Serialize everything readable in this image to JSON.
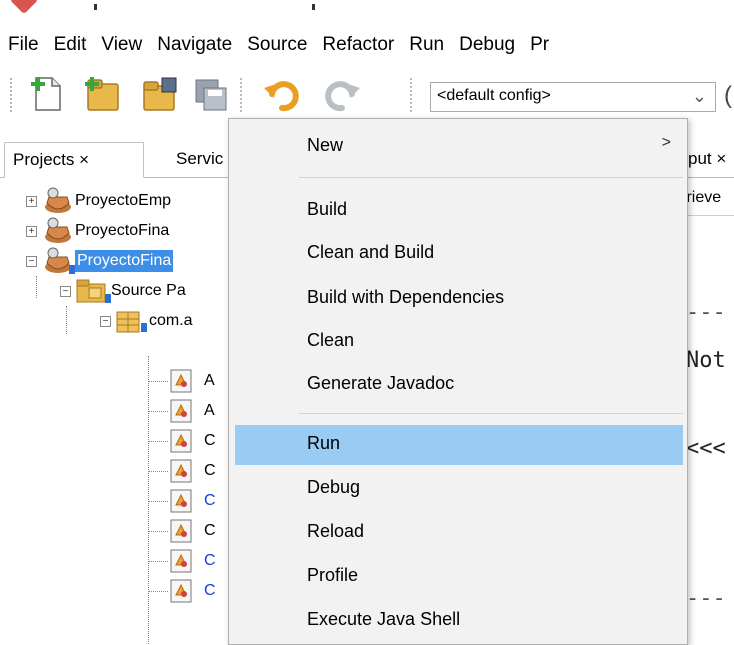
{
  "menu_bar": {
    "items": [
      "File",
      "Edit",
      "View",
      "Navigate",
      "Source",
      "Refactor",
      "Run",
      "Debug",
      "Pr"
    ]
  },
  "toolbar": {
    "config_value": "<default config>",
    "buttons": [
      {
        "name": "new-file-icon"
      },
      {
        "name": "new-project-icon"
      },
      {
        "name": "open-project-icon"
      },
      {
        "name": "save-all-icon"
      },
      {
        "name": "undo-icon"
      },
      {
        "name": "redo-icon"
      }
    ]
  },
  "tabs": {
    "projects": "Projects",
    "projects_close": "×",
    "services": "Servic",
    "output": "put ×"
  },
  "right_strip": {
    "retrieve": "trieve"
  },
  "tree": {
    "rows": [
      {
        "label": "ProyectoEmp",
        "type": "project"
      },
      {
        "label": "ProyectoFina",
        "type": "project"
      },
      {
        "label": "ProyectoFina",
        "type": "project",
        "selected": true
      },
      {
        "label": "Source Pa",
        "type": "source-package"
      },
      {
        "label": "com.a",
        "type": "package"
      },
      {
        "label": "A",
        "type": "java-file"
      },
      {
        "label": "A",
        "type": "java-file"
      },
      {
        "label": "C",
        "type": "java-file"
      },
      {
        "label": "C",
        "type": "java-file"
      },
      {
        "label": "C",
        "type": "java-file",
        "blue": true
      },
      {
        "label": "C",
        "type": "java-file"
      },
      {
        "label": "C",
        "type": "java-file",
        "blue": true
      },
      {
        "label": "C",
        "type": "java-file",
        "blue": true
      }
    ]
  },
  "editor_fragments": {
    "dashes_1": "---",
    "not": "Not",
    "arrows": "<<<",
    "dashes_2": "---"
  },
  "context_menu": {
    "items": [
      {
        "label": "New",
        "submenu": true,
        "chevron": ">"
      },
      {
        "label": "Build"
      },
      {
        "label": "Clean and Build"
      },
      {
        "label": "Build with Dependencies"
      },
      {
        "label": "Clean"
      },
      {
        "label": "Generate Javadoc"
      },
      {
        "label": "Run",
        "highlighted": true
      },
      {
        "label": "Debug"
      },
      {
        "label": "Reload"
      },
      {
        "label": "Profile"
      },
      {
        "label": "Execute Java Shell"
      }
    ]
  },
  "colors": {
    "selection": "#3d8ee6",
    "menu_hover": "#99cbf3",
    "menu_bg": "#f2f2f2"
  }
}
